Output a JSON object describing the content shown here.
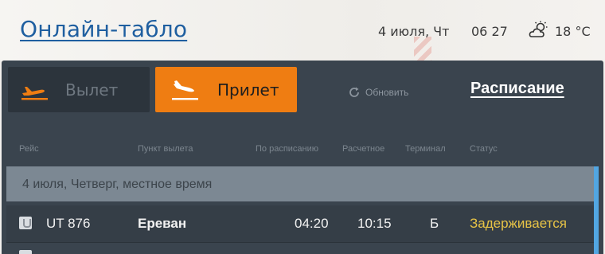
{
  "header": {
    "title": "Онлайн-табло",
    "date": "4 июля, Чт",
    "time": "06 27",
    "temperature": "18 °C",
    "weather_icon": "partly-cloudy-sun-icon"
  },
  "tabs": {
    "departure": "Вылет",
    "arrival": "Прилет",
    "active": "arrival"
  },
  "toolbar": {
    "refresh": "Обновить",
    "schedule": "Расписание"
  },
  "columns": [
    "Рейс",
    "Пункт вылета",
    "По расписанию",
    "Расчетное",
    "Терминал",
    "Статус"
  ],
  "date_row": "4 июля, Четверг, местное время",
  "flights": [
    {
      "flight": "UT 876",
      "origin": "Ереван",
      "scheduled": "04:20",
      "estimated": "10:15",
      "terminal": "Б",
      "status": "Задерживается"
    }
  ],
  "colors": {
    "accent": "#ef7d12",
    "panel": "#3a444e",
    "status_delayed": "#e7c346",
    "title_link": "#1f5fa0"
  }
}
